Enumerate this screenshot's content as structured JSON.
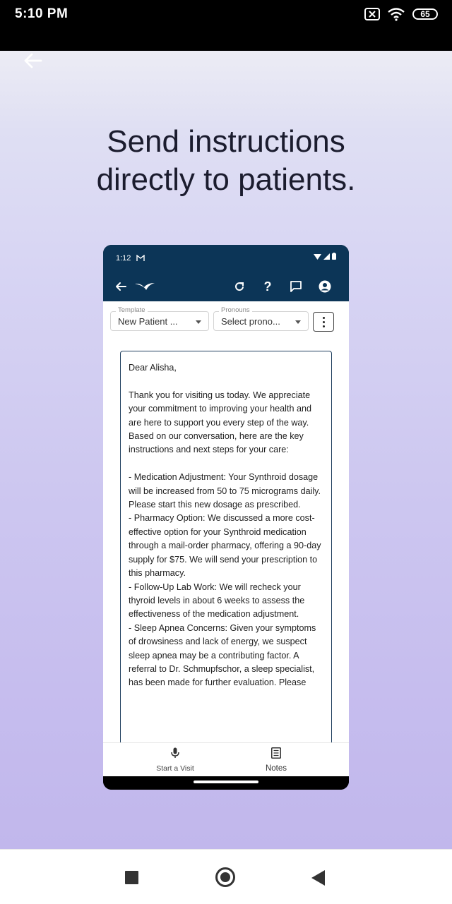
{
  "status_bar": {
    "time": "5:10 PM",
    "battery": "65"
  },
  "headline": {
    "line1": "Send instructions",
    "line2": "directly to patients."
  },
  "phone": {
    "status_time": "1:12",
    "template": {
      "label": "Template",
      "value": "New Patient ..."
    },
    "pronouns": {
      "label": "Pronouns",
      "value": "Select prono..."
    },
    "letter": "Dear Alisha,\n\nThank you for visiting us today. We appreciate your commitment to improving your health and are here to support you every step of the way. Based on our conversation, here are the key instructions and next steps for your care:\n\n- Medication Adjustment: Your Synthroid dosage will be increased from 50 to 75 micrograms daily. Please start this new dosage as prescribed.\n- Pharmacy Option: We discussed a more cost-effective option for your Synthroid medication through a mail-order pharmacy, offering a 90-day supply for $75. We will send your prescription to this pharmacy.\n- Follow-Up Lab Work: We will recheck your thyroid levels in about 6 weeks to assess the effectiveness of the medication adjustment.\n- Sleep Apnea Concerns: Given your symptoms of drowsiness and lack of energy, we suspect sleep apnea may be a contributing factor. A referral to Dr. Schmupfschor, a sleep specialist, has been made for further evaluation. Please",
    "nav": {
      "start_visit": "Start a Visit",
      "notes": "Notes"
    }
  },
  "colors": {
    "app_bar": "#0c3557",
    "headline": "#1b1c2e"
  }
}
